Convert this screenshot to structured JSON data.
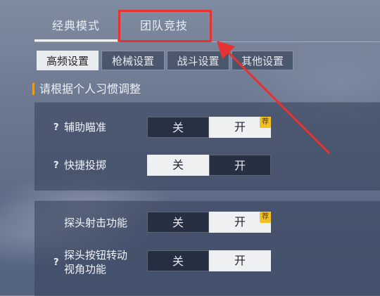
{
  "main_tabs": [
    {
      "label": "经典模式",
      "active": true
    },
    {
      "label": "团队竞技",
      "active": false
    }
  ],
  "sub_tabs": [
    {
      "label": "高频设置",
      "active": true
    },
    {
      "label": "枪械设置",
      "active": false
    },
    {
      "label": "战斗设置",
      "active": false
    },
    {
      "label": "其他设置",
      "active": false
    }
  ],
  "section_heading": "请根据个人习惯调整",
  "panel1": {
    "rows": [
      {
        "help": "?",
        "label": "辅助瞄准",
        "off": "关",
        "on": "开",
        "selected": "on",
        "recommended_badge": "荐"
      },
      {
        "help": "?",
        "label": "快捷投掷",
        "off": "关",
        "on": "开",
        "selected": "off"
      }
    ]
  },
  "panel2": {
    "rows": [
      {
        "label": "探头射击功能",
        "off": "关",
        "on": "开",
        "selected": "off",
        "recommended_badge": "荐"
      },
      {
        "help": "?",
        "label_line1": "探头按钮转动",
        "label_line2": "视角功能",
        "off": "关",
        "on": "开",
        "selected": "on"
      }
    ]
  },
  "colors": {
    "highlight_annotation": "#e53232",
    "badge": "#f0c020",
    "section_accent": "#e59a2a"
  }
}
